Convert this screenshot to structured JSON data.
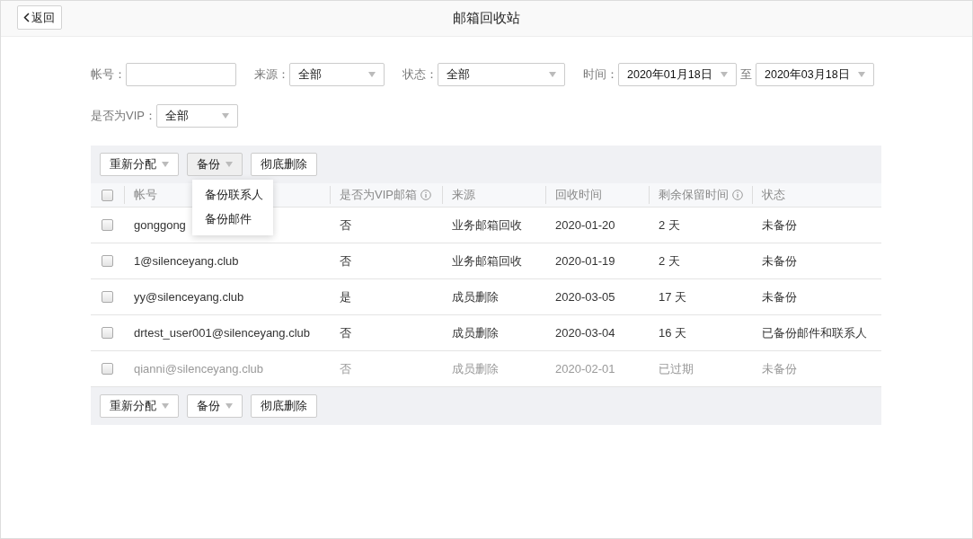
{
  "header": {
    "back_label": "返回",
    "title": "邮箱回收站"
  },
  "filters": [
    {
      "label": "帐号：",
      "kind": "input"
    },
    {
      "label": "来源：",
      "kind": "select",
      "value": "全部"
    },
    {
      "label": "状态：",
      "kind": "select",
      "value": "全部"
    },
    {
      "label": "时间：",
      "kind": "daterange",
      "from": "2020年01月18日",
      "separator": "至",
      "to": "2020年03月18日"
    },
    {
      "label": "是否为VIP：",
      "kind": "select",
      "value": "全部"
    }
  ],
  "toolbar_top": [
    {
      "label": "重新分配",
      "dropdown": true,
      "open": false
    },
    {
      "label": "备份",
      "dropdown": true,
      "open": true,
      "menu": [
        "备份联系人",
        "备份邮件"
      ]
    },
    {
      "label": "彻底删除",
      "dropdown": false,
      "open": false
    }
  ],
  "table": {
    "select_all_checked": false,
    "columns": [
      {
        "label": "帐号",
        "info": false
      },
      {
        "label": "是否为VIP邮箱",
        "info": true
      },
      {
        "label": "来源",
        "info": false
      },
      {
        "label": "回收时间",
        "info": false
      },
      {
        "label": "剩余保留时间",
        "info": true
      },
      {
        "label": "状态",
        "info": false
      }
    ],
    "rows": [
      {
        "checked": false,
        "expired": false,
        "cells": [
          "gonggong",
          "否",
          "业务邮箱回收",
          "2020-01-20",
          "2 天",
          "未备份"
        ]
      },
      {
        "checked": false,
        "expired": false,
        "cells": [
          "1@silenceyang.club",
          "否",
          "业务邮箱回收",
          "2020-01-19",
          "2 天",
          "未备份"
        ]
      },
      {
        "checked": false,
        "expired": false,
        "cells": [
          "yy@silenceyang.club",
          "是",
          "成员删除",
          "2020-03-05",
          "17 天",
          "未备份"
        ]
      },
      {
        "checked": false,
        "expired": false,
        "cells": [
          "drtest_user001@silenceyang.club",
          "否",
          "成员删除",
          "2020-03-04",
          "16 天",
          "已备份邮件和联系人"
        ]
      },
      {
        "checked": false,
        "expired": true,
        "cells": [
          "qianni@silenceyang.club",
          "否",
          "成员删除",
          "2020-02-01",
          "已过期",
          "未备份"
        ]
      }
    ]
  },
  "toolbar_bottom": [
    {
      "label": "重新分配",
      "dropdown": true,
      "open": false
    },
    {
      "label": "备份",
      "dropdown": true,
      "open": false
    },
    {
      "label": "彻底删除",
      "dropdown": false,
      "open": false
    }
  ]
}
